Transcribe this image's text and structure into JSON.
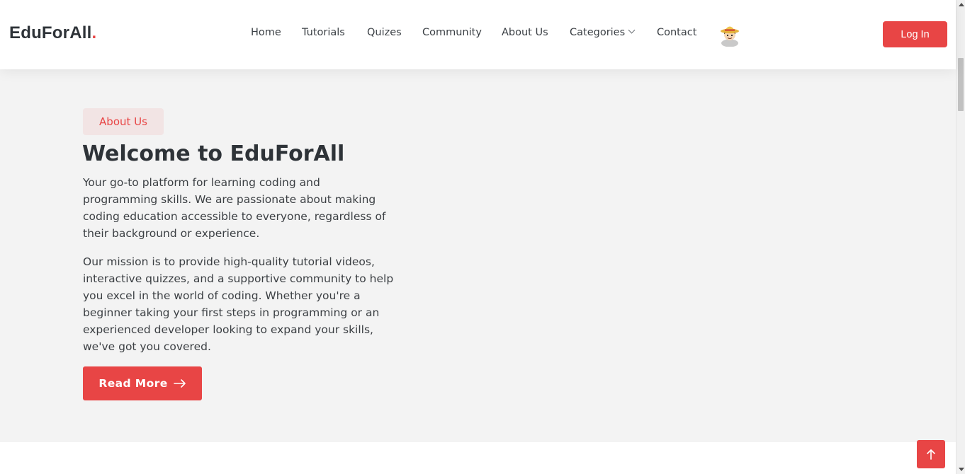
{
  "brand": {
    "name": "EduForAll",
    "dot": ".",
    "accent_color": "#e84545"
  },
  "nav": {
    "items": [
      {
        "label": "Home"
      },
      {
        "label": "Tutorials"
      },
      {
        "label": "Quizes"
      },
      {
        "label": "Community"
      },
      {
        "label": "About Us"
      },
      {
        "label": "Categories",
        "has_dropdown": true
      },
      {
        "label": "Contact"
      }
    ],
    "avatar_icon": "user-avatar-icon",
    "login_label": "Log In"
  },
  "about": {
    "badge": "About Us",
    "title": "Welcome to EduForAll",
    "paragraph_1": "Your go-to platform for learning coding and programming skills. We are passionate about making coding education accessible to everyone, regardless of their background or experience.",
    "paragraph_2": "Our mission is to provide high-quality tutorial videos, interactive quizzes, and a supportive community to help you excel in the world of coding. Whether you're a beginner taking your first steps in programming or an experienced developer looking to expand your skills, we've got you covered.",
    "read_more_label": "Read More",
    "read_more_icon": "arrow-right-icon"
  },
  "scroll_top": {
    "icon": "arrow-up-icon"
  }
}
